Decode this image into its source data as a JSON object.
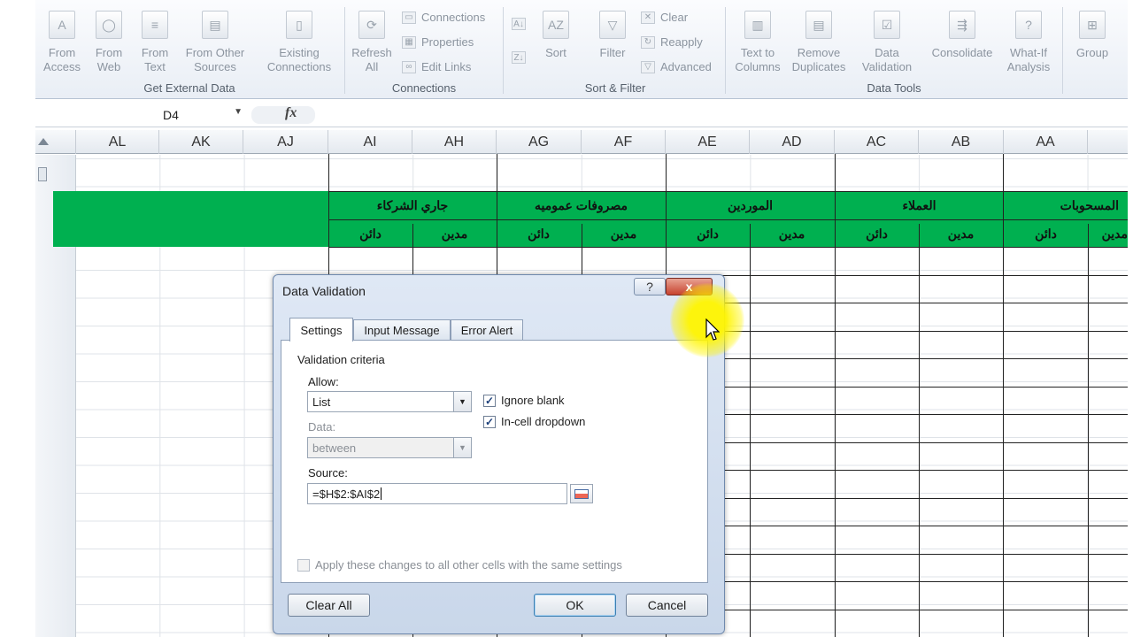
{
  "ribbon": {
    "groups": [
      {
        "label": "Get External Data"
      },
      {
        "label": "Connections"
      },
      {
        "label": "Sort & Filter"
      },
      {
        "label": "Data Tools"
      }
    ],
    "buttons": {
      "from_access": "From Access",
      "from_web": "From Web",
      "from_text": "From Text",
      "from_other": "From Other Sources",
      "existing": "Existing Connections",
      "refresh": "Refresh All",
      "connections": "Connections",
      "properties": "Properties",
      "edit_links": "Edit Links",
      "sort": "Sort",
      "filter": "Filter",
      "clear": "Clear",
      "reapply": "Reapply",
      "advanced": "Advanced",
      "text_to_columns": "Text to Columns",
      "remove_duplicates": "Remove Duplicates",
      "data_validation": "Data Validation",
      "consolidate": "Consolidate",
      "what_if": "What-If Analysis",
      "group": "Group"
    }
  },
  "formula_bar": {
    "name_box": "D4",
    "fx": "fx",
    "formula": ""
  },
  "columns": [
    "AL",
    "AK",
    "AJ",
    "AI",
    "AH",
    "AG",
    "AF",
    "AE",
    "AD",
    "AC",
    "AB",
    "AA"
  ],
  "sheet": {
    "headers": [
      {
        "label": "جاري الشركاء"
      },
      {
        "label": "مصروفات عموميه"
      },
      {
        "label": "الموردين"
      },
      {
        "label": "العملاء"
      },
      {
        "label": "المسحوبات"
      }
    ],
    "sub_labels": [
      "دائن",
      "مدين",
      "دائن",
      "مدين",
      "دائن",
      "مدين",
      "دائن",
      "مدين",
      "دائن",
      "مدين"
    ]
  },
  "dialog": {
    "title": "Data Validation",
    "help": "?",
    "close": "x",
    "tabs": [
      "Settings",
      "Input Message",
      "Error Alert"
    ],
    "active_tab": "Settings",
    "section": "Validation criteria",
    "allow_label": "Allow:",
    "allow_value": "List",
    "data_label": "Data:",
    "data_value": "between",
    "ignore_blank": {
      "label": "Ignore blank",
      "checked": true
    },
    "in_cell_dropdown": {
      "label": "In-cell dropdown",
      "checked": true
    },
    "source_label": "Source:",
    "source_value": "=$H$2:$AI$2",
    "apply_all": {
      "label": "Apply these changes to all other cells with the same settings",
      "checked": false
    },
    "clear_all": "Clear All",
    "ok": "OK",
    "cancel": "Cancel"
  }
}
